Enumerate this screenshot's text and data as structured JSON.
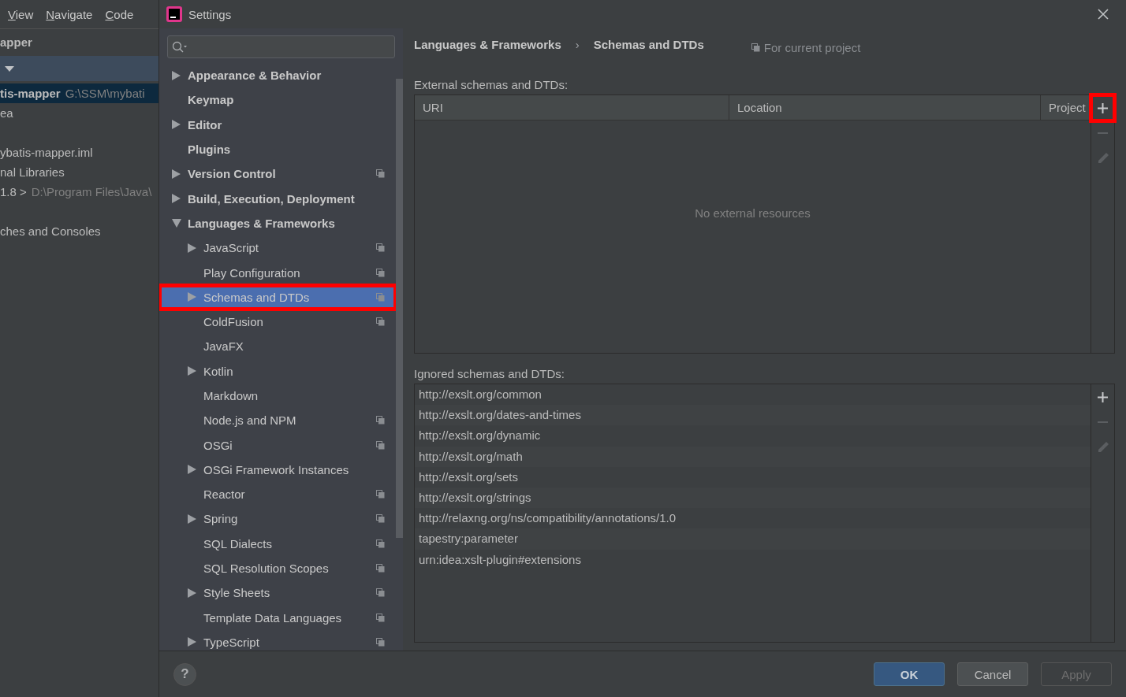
{
  "ide": {
    "menu": [
      {
        "label": "View"
      },
      {
        "label": "Navigate"
      },
      {
        "label": "Code"
      }
    ],
    "project_title": "apper",
    "tree": [
      {
        "name": "tis-mapper",
        "path": "G:\\SSM\\mybati",
        "selected": true
      },
      {
        "name": "ea",
        "selected": false
      },
      {
        "name": "ybatis-mapper.iml",
        "selected": false
      },
      {
        "name": "nal Libraries",
        "selected": false
      },
      {
        "name": "1.8 >",
        "path": "D:\\Program Files\\Java\\",
        "selected": false
      },
      {
        "name": "ches and Consoles",
        "selected": false
      }
    ]
  },
  "window": {
    "title": "Settings"
  },
  "sidebar": {
    "items": [
      {
        "label": "Appearance & Behavior",
        "expandable": true,
        "expanded": false,
        "project_scoped": false,
        "selected": false,
        "highlighted": false
      },
      {
        "label": "Keymap",
        "expandable": false,
        "project_scoped": false,
        "selected": false,
        "highlighted": false
      },
      {
        "label": "Editor",
        "expandable": true,
        "expanded": false,
        "project_scoped": false,
        "selected": false,
        "highlighted": false
      },
      {
        "label": "Plugins",
        "expandable": false,
        "project_scoped": false,
        "selected": false,
        "highlighted": false
      },
      {
        "label": "Version Control",
        "expandable": true,
        "expanded": false,
        "project_scoped": true,
        "selected": false,
        "highlighted": false
      },
      {
        "label": "Build, Execution, Deployment",
        "expandable": true,
        "expanded": false,
        "project_scoped": false,
        "selected": false,
        "highlighted": false
      },
      {
        "label": "Languages & Frameworks",
        "expandable": true,
        "expanded": true,
        "project_scoped": false,
        "selected": false,
        "highlighted": false,
        "children": [
          {
            "label": "JavaScript",
            "expandable": true,
            "expanded": false,
            "project_scoped": true,
            "selected": false,
            "highlighted": false
          },
          {
            "label": "Play Configuration",
            "expandable": false,
            "project_scoped": true,
            "selected": false,
            "highlighted": false
          },
          {
            "label": "Schemas and DTDs",
            "expandable": true,
            "expanded": false,
            "project_scoped": true,
            "selected": true,
            "highlighted": true
          },
          {
            "label": "ColdFusion",
            "expandable": false,
            "project_scoped": true,
            "selected": false,
            "highlighted": false
          },
          {
            "label": "JavaFX",
            "expandable": false,
            "project_scoped": false,
            "selected": false,
            "highlighted": false
          },
          {
            "label": "Kotlin",
            "expandable": true,
            "expanded": false,
            "project_scoped": false,
            "selected": false,
            "highlighted": false
          },
          {
            "label": "Markdown",
            "expandable": false,
            "project_scoped": false,
            "selected": false,
            "highlighted": false
          },
          {
            "label": "Node.js and NPM",
            "expandable": false,
            "project_scoped": true,
            "selected": false,
            "highlighted": false
          },
          {
            "label": "OSGi",
            "expandable": false,
            "project_scoped": true,
            "selected": false,
            "highlighted": false
          },
          {
            "label": "OSGi Framework Instances",
            "expandable": true,
            "expanded": false,
            "project_scoped": false,
            "selected": false,
            "highlighted": false
          },
          {
            "label": "Reactor",
            "expandable": false,
            "project_scoped": true,
            "selected": false,
            "highlighted": false
          },
          {
            "label": "Spring",
            "expandable": true,
            "expanded": false,
            "project_scoped": true,
            "selected": false,
            "highlighted": false
          },
          {
            "label": "SQL Dialects",
            "expandable": false,
            "project_scoped": true,
            "selected": false,
            "highlighted": false
          },
          {
            "label": "SQL Resolution Scopes",
            "expandable": false,
            "project_scoped": true,
            "selected": false,
            "highlighted": false
          },
          {
            "label": "Style Sheets",
            "expandable": true,
            "expanded": false,
            "project_scoped": true,
            "selected": false,
            "highlighted": false
          },
          {
            "label": "Template Data Languages",
            "expandable": false,
            "project_scoped": true,
            "selected": false,
            "highlighted": false
          },
          {
            "label": "TypeScript",
            "expandable": true,
            "expanded": false,
            "project_scoped": true,
            "selected": false,
            "highlighted": false
          }
        ]
      }
    ]
  },
  "breadcrumb": [
    "Languages & Frameworks",
    "Schemas and DTDs"
  ],
  "breadcrumb_separator": "›",
  "scope_note": "For current project",
  "external": {
    "label": "External schemas and DTDs:",
    "columns": [
      "URI",
      "Location",
      "Project"
    ],
    "empty_text": "No external resources",
    "tools": [
      {
        "kind": "add",
        "disabled": false,
        "highlighted": true
      },
      {
        "kind": "remove",
        "disabled": true,
        "highlighted": false
      },
      {
        "kind": "edit",
        "disabled": true,
        "highlighted": false
      }
    ]
  },
  "ignored": {
    "label": "Ignored schemas and DTDs:",
    "rows": [
      "http://exslt.org/common",
      "http://exslt.org/dates-and-times",
      "http://exslt.org/dynamic",
      "http://exslt.org/math",
      "http://exslt.org/sets",
      "http://exslt.org/strings",
      "http://relaxng.org/ns/compatibility/annotations/1.0",
      "tapestry:parameter",
      "urn:idea:xslt-plugin#extensions"
    ],
    "tools": [
      {
        "kind": "add",
        "disabled": false,
        "highlighted": false
      },
      {
        "kind": "remove",
        "disabled": true,
        "highlighted": false
      },
      {
        "kind": "edit",
        "disabled": true,
        "highlighted": false
      }
    ]
  },
  "help": "?",
  "buttons": [
    {
      "label": "OK",
      "kind": "default",
      "disabled": false
    },
    {
      "label": "Cancel",
      "kind": "normal",
      "disabled": false
    },
    {
      "label": "Apply",
      "kind": "normal",
      "disabled": true
    }
  ]
}
